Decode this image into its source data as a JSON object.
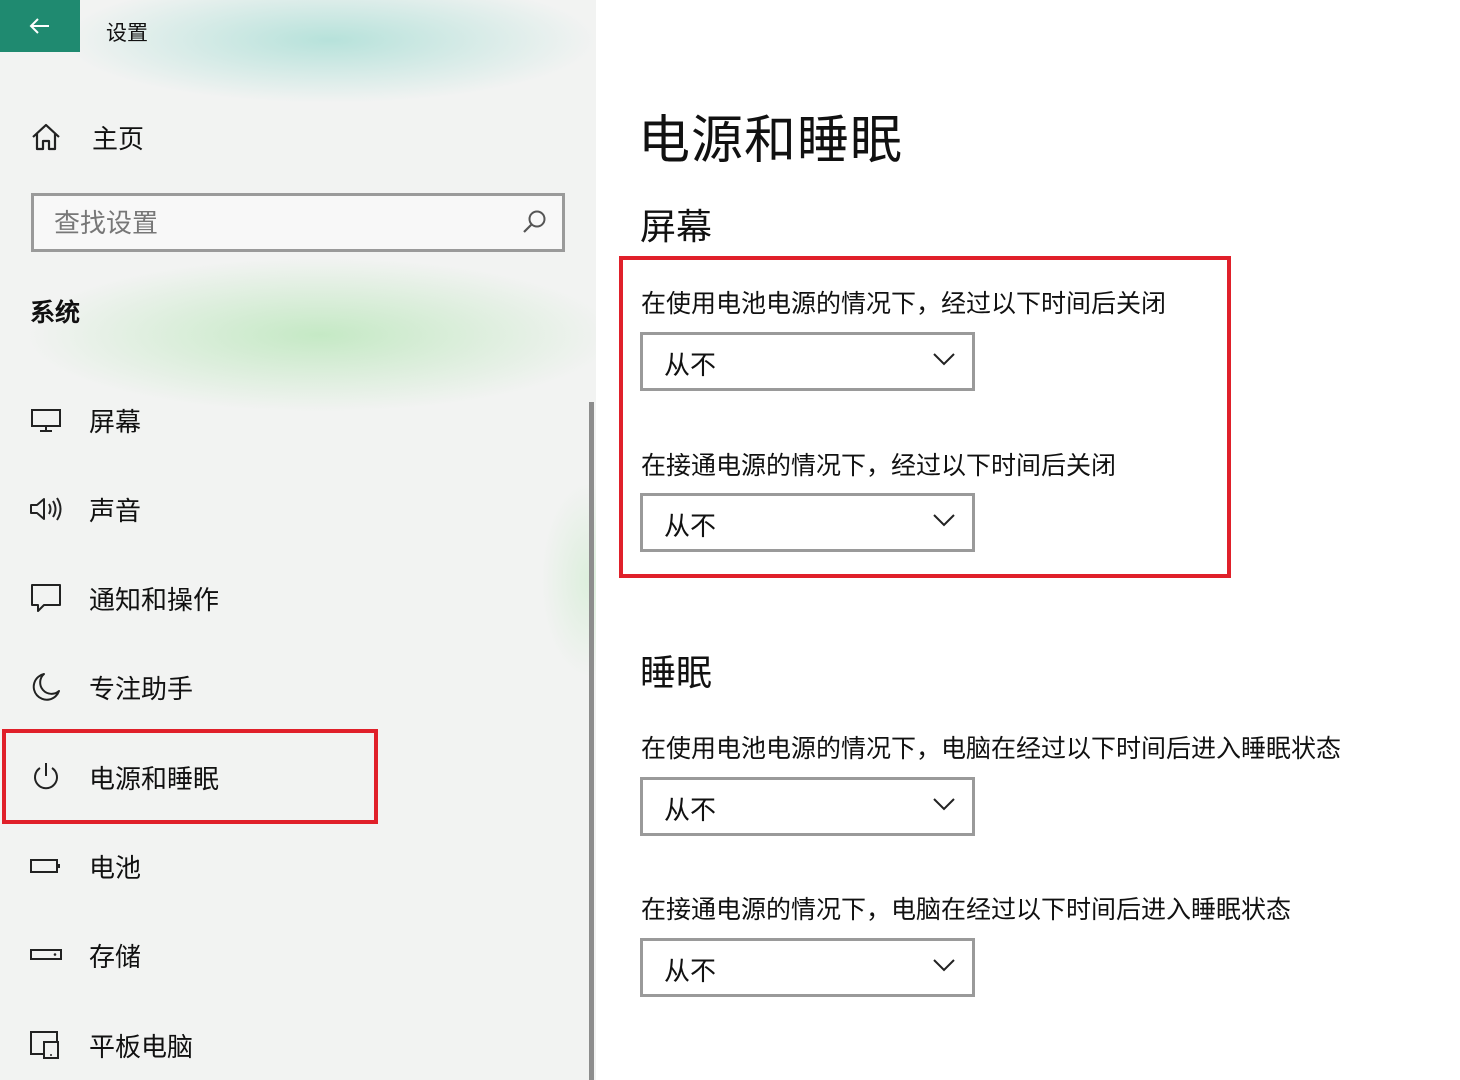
{
  "window": {
    "title": "设置",
    "accent_color": "#1f8a70",
    "highlight_color": "#e0202a"
  },
  "sidebar": {
    "back_icon": "back-arrow-icon",
    "home_label": "主页",
    "search_placeholder": "查找设置",
    "section_label": "系统",
    "items": [
      {
        "label": "屏幕",
        "icon": "monitor-icon"
      },
      {
        "label": "声音",
        "icon": "speaker-icon"
      },
      {
        "label": "通知和操作",
        "icon": "notification-icon"
      },
      {
        "label": "专注助手",
        "icon": "moon-icon"
      },
      {
        "label": "电源和睡眠",
        "icon": "power-icon",
        "selected": true
      },
      {
        "label": "电池",
        "icon": "battery-icon"
      },
      {
        "label": "存储",
        "icon": "storage-icon"
      },
      {
        "label": "平板电脑",
        "icon": "tablet-icon"
      }
    ]
  },
  "main": {
    "title": "电源和睡眠",
    "screen_section": {
      "heading": "屏幕",
      "battery_label": "在使用电池电源的情况下，经过以下时间后关闭",
      "battery_value": "从不",
      "plugged_label": "在接通电源的情况下，经过以下时间后关闭",
      "plugged_value": "从不"
    },
    "sleep_section": {
      "heading": "睡眠",
      "battery_label": "在使用电池电源的情况下，电脑在经过以下时间后进入睡眠状态",
      "battery_value": "从不",
      "plugged_label": "在接通电源的情况下，电脑在经过以下时间后进入睡眠状态",
      "plugged_value": "从不"
    }
  }
}
